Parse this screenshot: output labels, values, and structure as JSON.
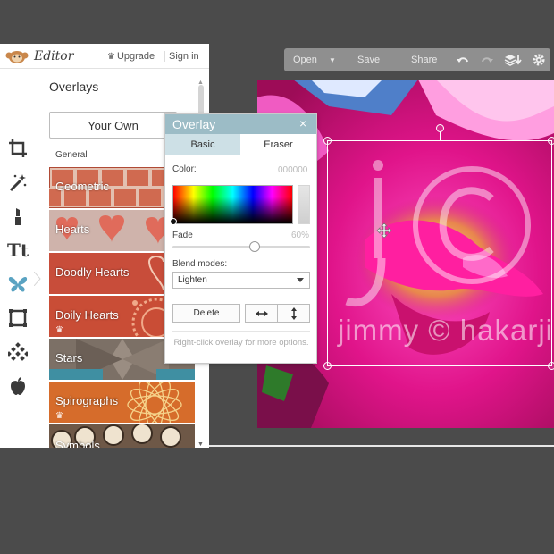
{
  "app": {
    "name": "Editor",
    "upgrade_label": "Upgrade",
    "signin_label": "Sign in",
    "logo_icon": "monkey-logo-icon"
  },
  "toolbar": {
    "tools": [
      {
        "name": "crop-icon"
      },
      {
        "name": "magic-wand-icon"
      },
      {
        "name": "lipstick-icon"
      },
      {
        "name": "text-icon",
        "label": "Tt"
      },
      {
        "name": "butterfly-icon",
        "active": true
      },
      {
        "name": "frame-icon"
      },
      {
        "name": "texture-icon"
      },
      {
        "name": "apple-icon"
      }
    ]
  },
  "overlays_panel": {
    "title": "Overlays",
    "your_own_label": "Your Own",
    "category": "General",
    "tiles": [
      {
        "label": "Geometric",
        "premium": false
      },
      {
        "label": "Hearts",
        "premium": false
      },
      {
        "label": "Doodly Hearts",
        "premium": false
      },
      {
        "label": "Doily Hearts",
        "premium": true
      },
      {
        "label": "Stars",
        "premium": false
      },
      {
        "label": "Spirographs",
        "premium": true
      },
      {
        "label": "Symbols",
        "premium": false
      }
    ]
  },
  "actions": {
    "open_label": "Open",
    "save_label": "Save",
    "share_label": "Share"
  },
  "overlay_dialog": {
    "title": "Overlay",
    "close_glyph": "×",
    "tabs": {
      "basic": "Basic",
      "eraser": "Eraser"
    },
    "active_tab": "basic",
    "color_label": "Color:",
    "color_value": "000000",
    "fade_label": "Fade",
    "fade_value": "60%",
    "fade_level": 0.6,
    "blend_label": "Blend modes:",
    "blend_selected": "Lighten",
    "delete_label": "Delete",
    "hint": "Right-click overlay for more options."
  },
  "canvas": {
    "watermark_letters": "jc",
    "watermark_text": "jimmy © hakarji"
  },
  "colors": {
    "accent": "#9cbcc6",
    "tab_active": "#cde0e6",
    "toolbar_icon": "#3a3a3a",
    "active_icon": "#5aa3c2",
    "photo_magenta": "#e21c8e"
  }
}
